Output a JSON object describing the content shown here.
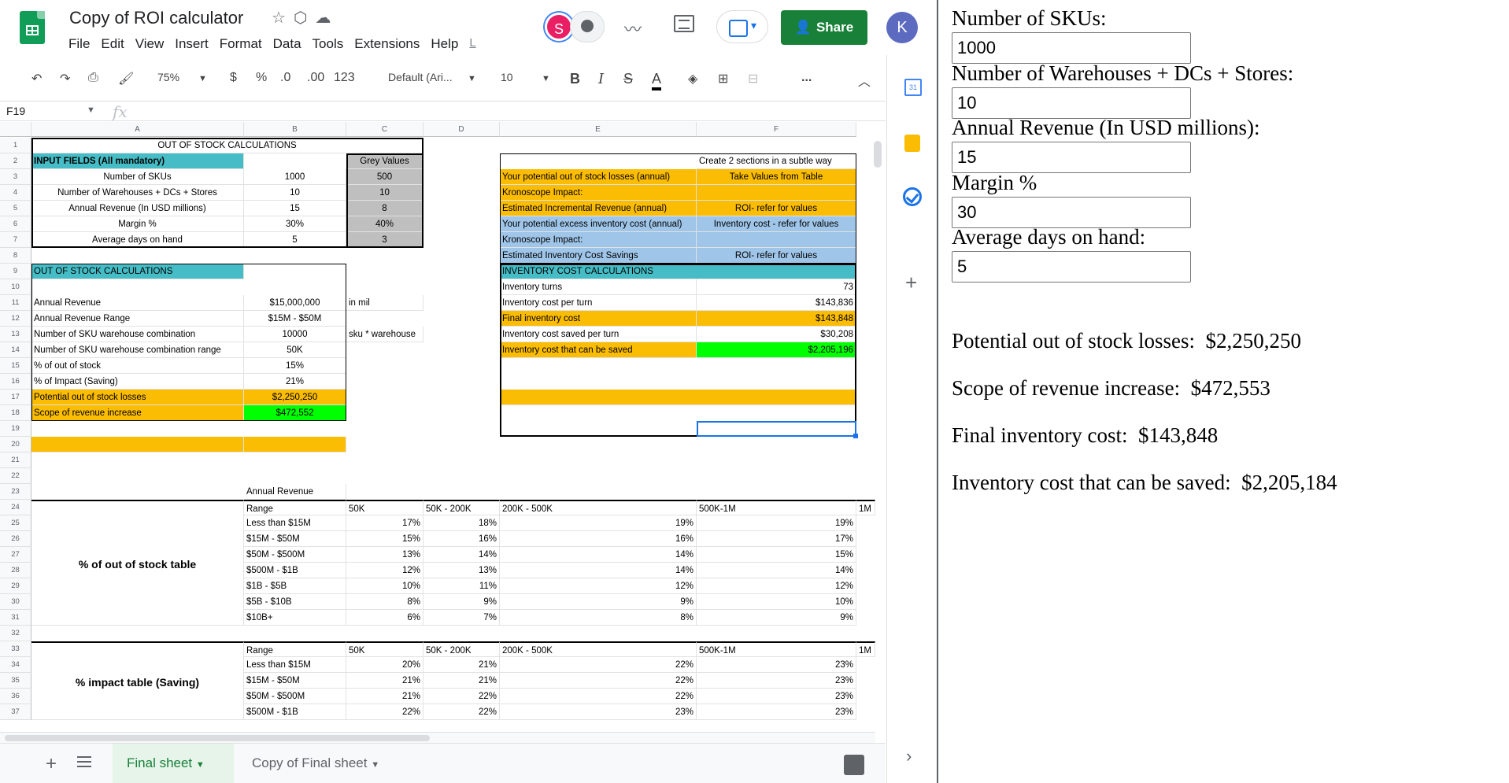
{
  "doc": {
    "title": "Copy of ROI calculator"
  },
  "menu": [
    "File",
    "Edit",
    "View",
    "Insert",
    "Format",
    "Data",
    "Tools",
    "Extensions",
    "Help",
    "L"
  ],
  "header": {
    "share_label": "Share",
    "avatar_s": "S",
    "avatar_k": "K"
  },
  "toolbar": {
    "zoom": "75%",
    "currency": "$",
    "percent": "%",
    "dec_less": ".0",
    "dec_more": ".00",
    "format_more": "123",
    "font": "Default (Ari...",
    "font_size": "10",
    "bold": "B",
    "italic": "I",
    "strike": "S",
    "text_color": "A",
    "more": "..."
  },
  "formula_bar": {
    "cell_ref": "F19",
    "fx": "fx",
    "value": ""
  },
  "columns": [
    "A",
    "B",
    "C",
    "D",
    "E",
    "F"
  ],
  "rows": [
    "1",
    "2",
    "3",
    "4",
    "5",
    "6",
    "7",
    "8",
    "9",
    "10",
    "11",
    "12",
    "13",
    "14",
    "15",
    "16",
    "17",
    "18",
    "19",
    "20",
    "21",
    "22",
    "23",
    "24",
    "25",
    "26",
    "27",
    "28",
    "29",
    "30",
    "31",
    "32",
    "33",
    "34",
    "35",
    "36",
    "37"
  ],
  "colors": {
    "blue_header": "#46bdc6",
    "orange": "#fbbc04",
    "green": "#00ff00",
    "grey": "#bfbfbf",
    "light_blue": "#9fc5e8",
    "share_green": "#188038"
  },
  "cells": {
    "r1": {
      "a": "OUT OF STOCK CALCULATIONS"
    },
    "r2": {
      "a": "INPUT FIELDS (All mandatory)",
      "c": "Grey Values"
    },
    "r3": {
      "a": "Number of SKUs",
      "b": "1000",
      "c": "500",
      "e": "Your potential out of stock losses (annual)",
      "f": "Take Values from Table"
    },
    "r2f": "Create 2 sections in a subtle way",
    "r4": {
      "a": "Number of Warehouses + DCs + Stores",
      "b": "10",
      "c": "10",
      "e": "Kronoscope Impact:"
    },
    "r5": {
      "a": "Annual Revenue (In USD millions)",
      "b": "15",
      "c": "8",
      "e": "Estimated Incremental Revenue (annual)",
      "f": "ROI- refer for values"
    },
    "r6": {
      "a": "Margin %",
      "b": "30%",
      "c": "40%",
      "e": "Your potential excess inventory cost (annual)",
      "f": "Inventory cost - refer for values"
    },
    "r7": {
      "a": "Average days on hand",
      "b": "5",
      "c": "3",
      "e": "Kronoscope Impact:"
    },
    "r8": {
      "e": "Estimated Inventory Cost Savings",
      "f": "ROI- refer for values"
    },
    "r9": {
      "a": "OUT OF STOCK CALCULATIONS",
      "e": "INVENTORY COST CALCULATIONS"
    },
    "r10": {
      "e": "Inventory turns",
      "f": "73"
    },
    "r11": {
      "a": "Annual Revenue",
      "b": "$15,000,000",
      "c": "in mil",
      "e": "Inventory cost per turn",
      "f": "$143,836"
    },
    "r12": {
      "a": "Annual Revenue Range",
      "b": "$15M - $50M",
      "e": "Final inventory cost",
      "f": "$143,848"
    },
    "r13": {
      "a": "Number of SKU warehouse combination",
      "b": "10000",
      "c": "sku * warehouse",
      "e": "Inventory cost saved per turn",
      "f": "$30,208"
    },
    "r14": {
      "a": "Number of SKU warehouse combination range",
      "b": "50K",
      "e": "Inventory cost that can be saved",
      "f": "$2,205,196"
    },
    "r15": {
      "a": "% of out of stock",
      "b": "15%"
    },
    "r16": {
      "a": "% of Impact (Saving)",
      "b": "21%"
    },
    "r17": {
      "a": "Potential out of stock losses",
      "b": "$2,250,250"
    },
    "r18": {
      "a": "Scope of revenue increase",
      "b": "$472,552"
    },
    "r23": {
      "b": "Annual Revenue"
    },
    "t1": {
      "label": "% of out of stock table",
      "header": [
        "Range",
        "50K",
        "50K - 200K",
        "200K - 500K",
        "500K-1M",
        "1M"
      ],
      "rows": [
        [
          "Less than $15M",
          "17%",
          "18%",
          "19%",
          "19%"
        ],
        [
          "$15M - $50M",
          "15%",
          "16%",
          "16%",
          "17%"
        ],
        [
          "$50M - $500M",
          "13%",
          "14%",
          "14%",
          "15%"
        ],
        [
          "$500M - $1B",
          "12%",
          "13%",
          "14%",
          "14%"
        ],
        [
          "$1B - $5B",
          "10%",
          "11%",
          "12%",
          "12%"
        ],
        [
          "$5B - $10B",
          "8%",
          "9%",
          "9%",
          "10%"
        ],
        [
          "$10B+",
          "6%",
          "7%",
          "8%",
          "9%"
        ]
      ]
    },
    "t2": {
      "label": "% impact table (Saving)",
      "header": [
        "Range",
        "50K",
        "50K - 200K",
        "200K - 500K",
        "500K-1M",
        "1M"
      ],
      "rows": [
        [
          "Less than $15M",
          "20%",
          "21%",
          "22%",
          "23%"
        ],
        [
          "$15M - $50M",
          "21%",
          "21%",
          "22%",
          "23%"
        ],
        [
          "$50M - $500M",
          "21%",
          "22%",
          "22%",
          "23%"
        ],
        [
          "$500M - $1B",
          "22%",
          "22%",
          "23%",
          "23%"
        ]
      ]
    }
  },
  "tabs": [
    {
      "label": "Final sheet",
      "active": true
    },
    {
      "label": "Copy of Final sheet",
      "active": false
    }
  ],
  "side_panel": {
    "calendar_label": "31"
  },
  "form": {
    "fields": [
      {
        "label": "Number of SKUs:",
        "value": "1000"
      },
      {
        "label": "Number of Warehouses + DCs + Stores:",
        "value": "10"
      },
      {
        "label": "Annual Revenue (In USD millions):",
        "value": "15"
      },
      {
        "label": "Margin %",
        "value": "30"
      },
      {
        "label": "Average days on hand:",
        "value": "5"
      }
    ],
    "results": [
      {
        "label": "Potential out of stock losses:",
        "value": "$2,250,250"
      },
      {
        "label": "Scope of revenue increase:",
        "value": "$472,553"
      },
      {
        "label": "Final inventory cost:",
        "value": "$143,848"
      },
      {
        "label": "Inventory cost that can be saved:",
        "value": "$2,205,184"
      }
    ]
  }
}
